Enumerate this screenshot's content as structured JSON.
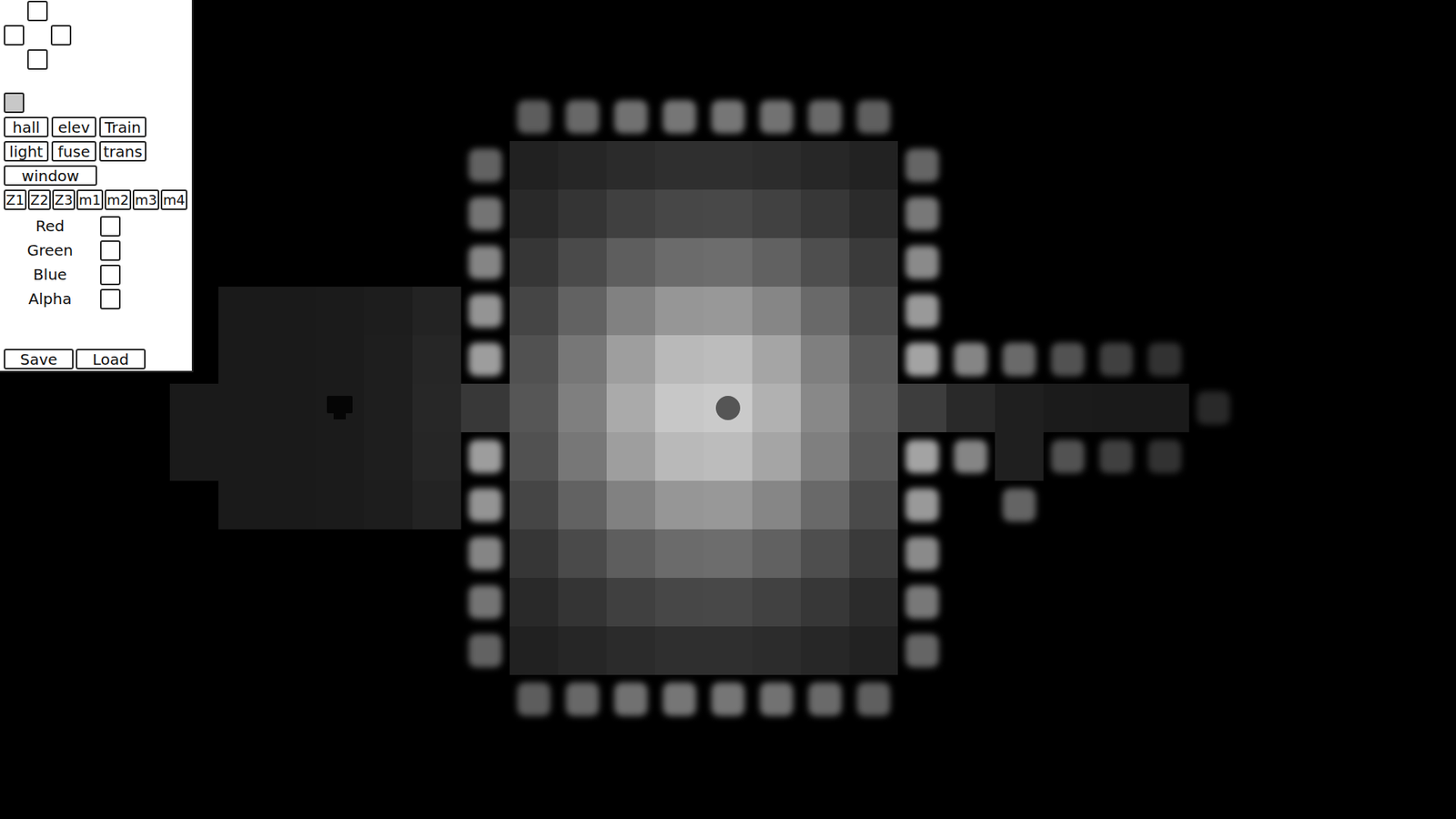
{
  "panel": {
    "tool_rows": [
      [
        "hall",
        "elev",
        "Train"
      ],
      [
        "light",
        "fuse",
        "trans"
      ],
      [
        "window"
      ]
    ],
    "layers": [
      "Z1",
      "Z2",
      "Z3",
      "m1",
      "m2",
      "m3",
      "m4"
    ],
    "channels": [
      {
        "label": "Red",
        "checked": false
      },
      {
        "label": "Green",
        "checked": false
      },
      {
        "label": "Blue",
        "checked": false
      },
      {
        "label": "Alpha",
        "checked": false
      }
    ],
    "actions": [
      "Save",
      "Load"
    ]
  },
  "map": {
    "rows": [
      ".......wwwwwwww.......",
      "......wffffffffw......",
      "......wffffffffw......",
      "......wffffffffw......",
      ".fffffwffffffffw......",
      ".fffffwffffffffwwwwww.",
      "fffffffffffffffffffffw",
      "ffffffwffffffffwwfwww.",
      ".fffffwffffffffw.w....",
      "......wffffffffw......",
      "......wffffffffw......",
      "......wffffffffw......",
      ".......wwwwwwww......."
    ],
    "light": {
      "col": 10.6,
      "row": 6,
      "intensity": 0.7,
      "ambient": 0.1
    },
    "objects": [
      {
        "kind": "player",
        "col": 11,
        "row": 6
      },
      {
        "kind": "marker",
        "col": 3,
        "row": 6
      }
    ]
  }
}
